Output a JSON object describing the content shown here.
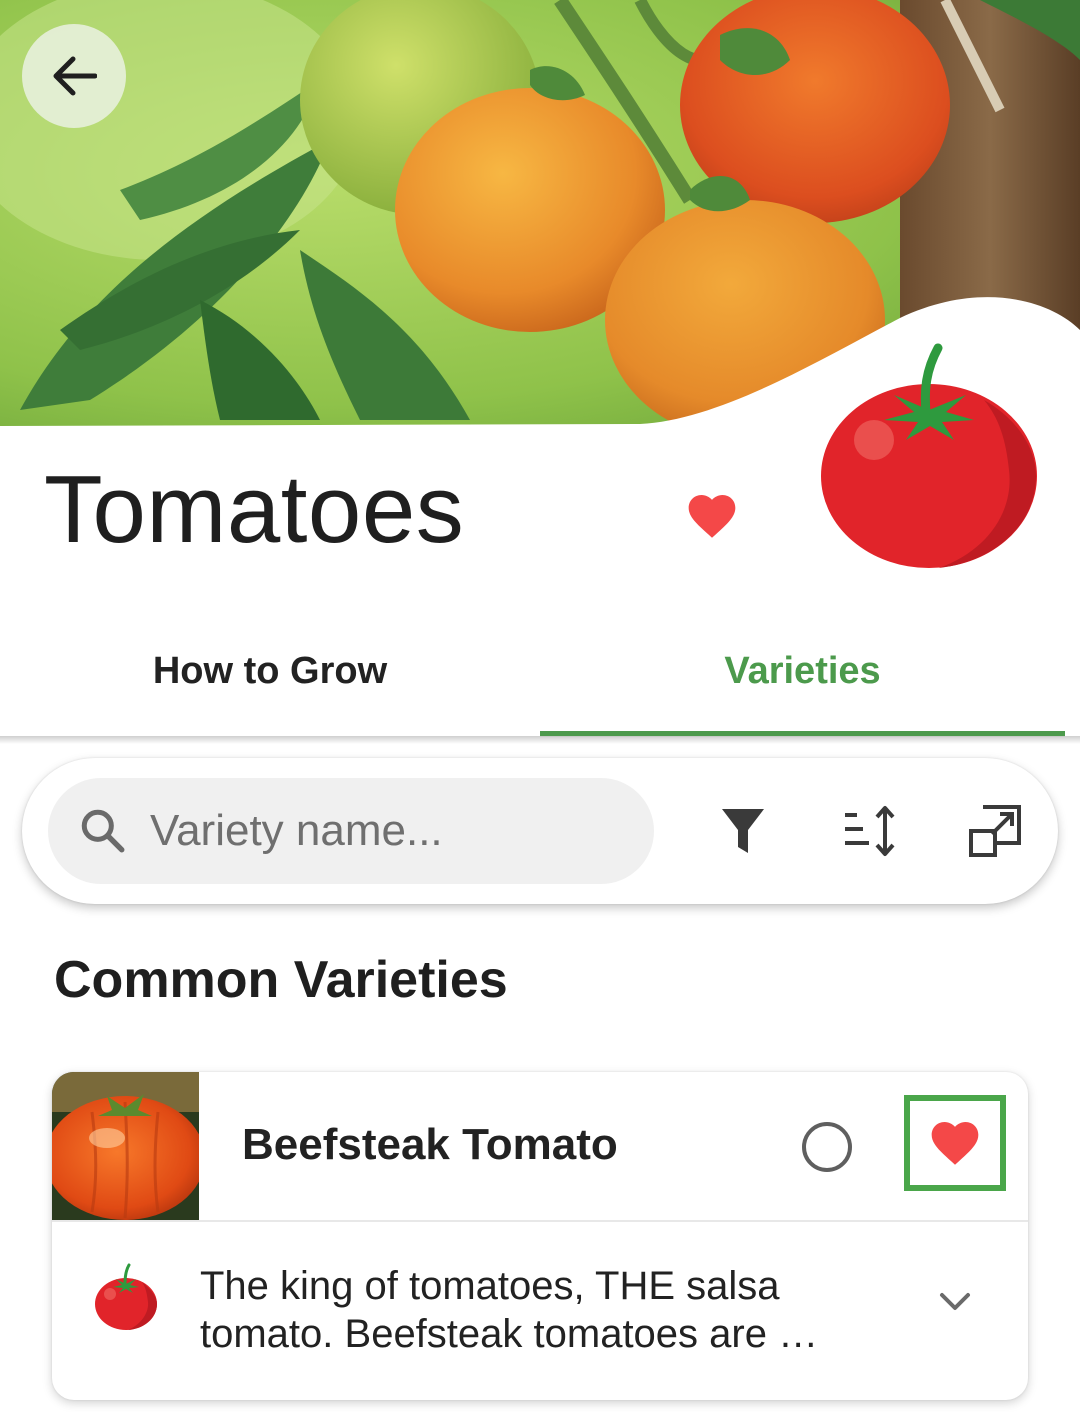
{
  "header": {
    "title": "Tomatoes",
    "back_icon": "arrow-left-icon",
    "favorite_icon": "heart-icon",
    "emblem_icon": "tomato-icon"
  },
  "tabs": [
    {
      "label": "How to Grow",
      "active": false
    },
    {
      "label": "Varieties",
      "active": true
    }
  ],
  "search": {
    "placeholder": "Variety name...",
    "value": "",
    "icons": [
      "search-icon",
      "filter-icon",
      "sort-icon",
      "expand-icon"
    ]
  },
  "section": {
    "title": "Common Varieties"
  },
  "varieties": [
    {
      "name": "Beefsteak Tomato",
      "description": "The king of tomatoes, THE salsa\ntomato. Beefsteak tomatoes are …",
      "selected": false,
      "favorite": true
    }
  ],
  "colors": {
    "accent": "#4c9a4c",
    "heart": "#f44848",
    "tomato": "#e1242a"
  }
}
